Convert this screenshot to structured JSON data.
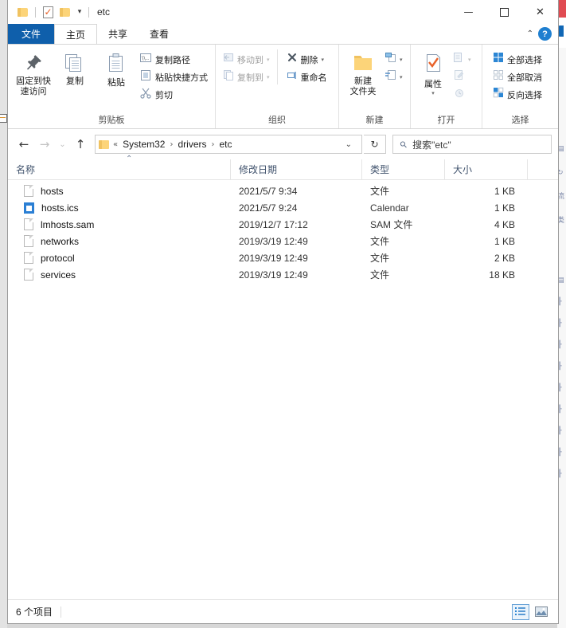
{
  "window": {
    "title": "etc",
    "quick_access": [
      {
        "name": "folder-icon",
        "label": "文件夹"
      },
      {
        "name": "properties-icon",
        "label": "属性"
      },
      {
        "name": "folder-icon",
        "label": "新建文件夹"
      },
      {
        "name": "chevron-down-icon",
        "label": "自定义快速访问工具栏"
      }
    ],
    "controls": {
      "minimize": "—",
      "maximize": "▢",
      "close": "✕"
    }
  },
  "tabs": [
    {
      "label": "文件",
      "id": "file"
    },
    {
      "label": "主页",
      "id": "home"
    },
    {
      "label": "共享",
      "id": "share"
    },
    {
      "label": "查看",
      "id": "view"
    }
  ],
  "ribbon": {
    "collapse_icon": "⌃",
    "help_icon": "?",
    "groups": [
      {
        "title": "剪贴板",
        "big": [
          {
            "label": "固定到快速访问",
            "icon": "pin-icon",
            "enabled": true
          },
          {
            "label": "复制",
            "icon": "copy-icon",
            "enabled": true
          },
          {
            "label": "粘贴",
            "icon": "paste-icon",
            "enabled": true
          }
        ],
        "small": [
          {
            "label": "复制路径",
            "icon": "copy-path-icon",
            "enabled": true
          },
          {
            "label": "粘贴快捷方式",
            "icon": "paste-shortcut-icon",
            "enabled": true
          },
          {
            "label": "剪切",
            "icon": "cut-icon",
            "enabled": true
          }
        ]
      },
      {
        "title": "组织",
        "small": [
          {
            "label": "移动到",
            "icon": "move-to-icon",
            "enabled": false,
            "caret": "▾"
          },
          {
            "label": "复制到",
            "icon": "copy-to-icon",
            "enabled": false,
            "caret": "▾"
          },
          {
            "label": "删除",
            "icon": "delete-icon",
            "enabled": true,
            "caret": "▾"
          },
          {
            "label": "重命名",
            "icon": "rename-icon",
            "enabled": true
          }
        ]
      },
      {
        "title": "新建",
        "big": [
          {
            "label": "新建\n文件夹",
            "icon": "new-folder-icon",
            "enabled": true
          }
        ],
        "small": [
          {
            "label": "",
            "icon": "new-item-icon",
            "enabled": true,
            "caret": "▾"
          },
          {
            "label": "",
            "icon": "easy-access-icon",
            "enabled": true,
            "caret": "▾"
          }
        ]
      },
      {
        "title": "打开",
        "big": [
          {
            "label": "属性",
            "icon": "properties-icon",
            "enabled": true,
            "caret": "▾"
          }
        ],
        "small": [
          {
            "label": "",
            "icon": "open-with-icon",
            "enabled": false,
            "caret": "▾"
          },
          {
            "label": "",
            "icon": "edit-icon",
            "enabled": false
          },
          {
            "label": "",
            "icon": "history-icon",
            "enabled": false
          }
        ]
      },
      {
        "title": "选择",
        "small": [
          {
            "label": "全部选择",
            "icon": "select-all-icon",
            "enabled": true
          },
          {
            "label": "全部取消",
            "icon": "select-none-icon",
            "enabled": true
          },
          {
            "label": "反向选择",
            "icon": "invert-selection-icon",
            "enabled": true
          }
        ]
      }
    ]
  },
  "navigation": {
    "back_icon": "←",
    "forward_icon": "→",
    "recent_icon": "⌄",
    "up_icon": "↑",
    "breadcrumb_prefix": "«",
    "breadcrumb": [
      "System32",
      "drivers",
      "etc"
    ],
    "breadcrumb_separator": "›",
    "address_dropdown_icon": "⌄",
    "refresh_icon": "↻"
  },
  "search": {
    "icon": "search-icon",
    "placeholder": "搜索\"etc\""
  },
  "columns": [
    {
      "label": "名称",
      "key": "name"
    },
    {
      "label": "修改日期",
      "key": "date"
    },
    {
      "label": "类型",
      "key": "type"
    },
    {
      "label": "大小",
      "key": "size"
    }
  ],
  "sort": {
    "column": "名称",
    "direction": "asc",
    "indicator": "⌃"
  },
  "files": [
    {
      "name": "hosts",
      "date": "2021/5/7 9:34",
      "type": "文件",
      "size": "1 KB",
      "icon": "document-icon"
    },
    {
      "name": "hosts.ics",
      "date": "2021/5/7 9:24",
      "type": "Calendar",
      "size": "1 KB",
      "icon": "calendar-icon"
    },
    {
      "name": "lmhosts.sam",
      "date": "2019/12/7 17:12",
      "type": "SAM 文件",
      "size": "4 KB",
      "icon": "document-icon"
    },
    {
      "name": "networks",
      "date": "2019/3/19 12:49",
      "type": "文件",
      "size": "1 KB",
      "icon": "document-icon"
    },
    {
      "name": "protocol",
      "date": "2019/3/19 12:49",
      "type": "文件",
      "size": "2 KB",
      "icon": "document-icon"
    },
    {
      "name": "services",
      "date": "2019/3/19 12:49",
      "type": "文件",
      "size": "18 KB",
      "icon": "document-icon"
    }
  ],
  "status": {
    "item_count": "6 个项目",
    "views": [
      {
        "name": "details-view-button",
        "selected": true
      },
      {
        "name": "large-icons-view-button",
        "selected": false
      }
    ]
  },
  "colors": {
    "accent": "#0f5fab",
    "header_text": "#41536d",
    "folder": "#fcd479",
    "help_blue": "#1f7fd0",
    "check_orange": "#e8622a"
  }
}
